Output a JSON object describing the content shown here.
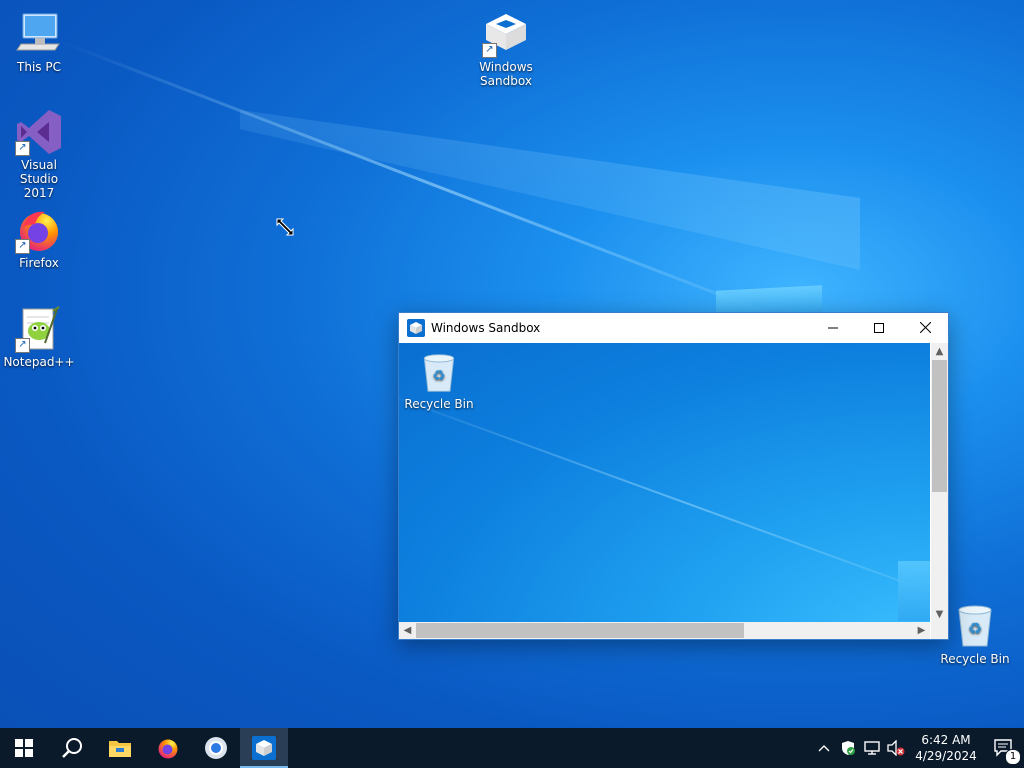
{
  "desktop": {
    "icons": [
      {
        "label_line1": "This PC",
        "label_line2": ""
      },
      {
        "label_line1": "Visual Studio",
        "label_line2": "2017"
      },
      {
        "label_line1": "Firefox",
        "label_line2": ""
      },
      {
        "label_line1": "Notepad++",
        "label_line2": ""
      },
      {
        "label_line1": "Windows",
        "label_line2": "Sandbox"
      },
      {
        "label_line1": "Recycle Bin",
        "label_line2": ""
      }
    ]
  },
  "sandbox_window": {
    "title": "Windows Sandbox",
    "minimize_glyph": "—",
    "maximize_glyph": "☐",
    "close_glyph": "✕",
    "inner_icons": [
      {
        "label": "Recycle Bin"
      }
    ]
  },
  "taskbar": {
    "apps": [
      "start-icon",
      "search-icon",
      "file-explorer-icon",
      "firefox-icon",
      "chrome-icon",
      "windows-sandbox-icon"
    ],
    "active_app": "windows-sandbox-icon"
  },
  "tray": {
    "chevron": "^",
    "time": "6:42 AM",
    "date": "4/29/2024",
    "notification_count": "1"
  },
  "colors": {
    "taskbar_bg": "#0a1a2b",
    "accent": "#0078d7",
    "desktop_blue": "#0f6fd6"
  }
}
